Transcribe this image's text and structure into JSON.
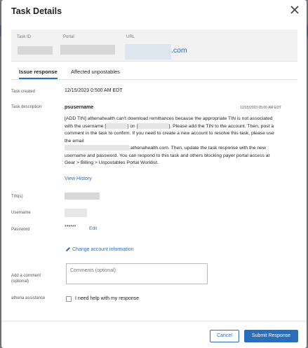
{
  "window": {
    "title": "Task Details"
  },
  "id_panel": {
    "task_id_label": "Task ID",
    "portal_label": "Portal",
    "url_label": "URL",
    "url_suffix": ".com"
  },
  "tabs": [
    {
      "label": "Issue response",
      "active": true
    },
    {
      "label": "Affected unpostables",
      "active": false
    }
  ],
  "fields": {
    "task_created_label": "Task created",
    "task_created_value": "12/15/2023 0:500 AM EDT",
    "task_description_label": "Task description",
    "tin_label": "TIN(s)",
    "username_label": "Username",
    "password_label": "Password",
    "password_value": "******",
    "edit_label": "Edit",
    "comment_label": "Add a comment (optional)",
    "comment_placeholder": "Comments (optional)",
    "assistance_label": "athena assistance",
    "assistance_checkbox_label": "I need help with my response"
  },
  "description": {
    "author": "psusername",
    "timestamp": "12/15/2023 05:00 AM EDT",
    "seg1": "[ADD TIN] athenahealth can't download remittances because the appropriate TIN is not associated with the username [",
    "seg2": "] on [",
    "seg3": "]. Please add the TIN to the account. Then, post a comment in the task to confirm. If you need to create a new account to resolve this task, please use the email",
    "seg4": ".athenahealth.com. Then, update the task response with the new username and password. You can respond to this task and others blocking payer portal access at Gear > Billing > Unpostables Portal Worklist."
  },
  "links": {
    "view_history": "View History",
    "change_account": "Change account information"
  },
  "footer": {
    "cancel": "Cancel",
    "submit": "Submit Response"
  },
  "colors": {
    "accent": "#2a6ebb"
  }
}
